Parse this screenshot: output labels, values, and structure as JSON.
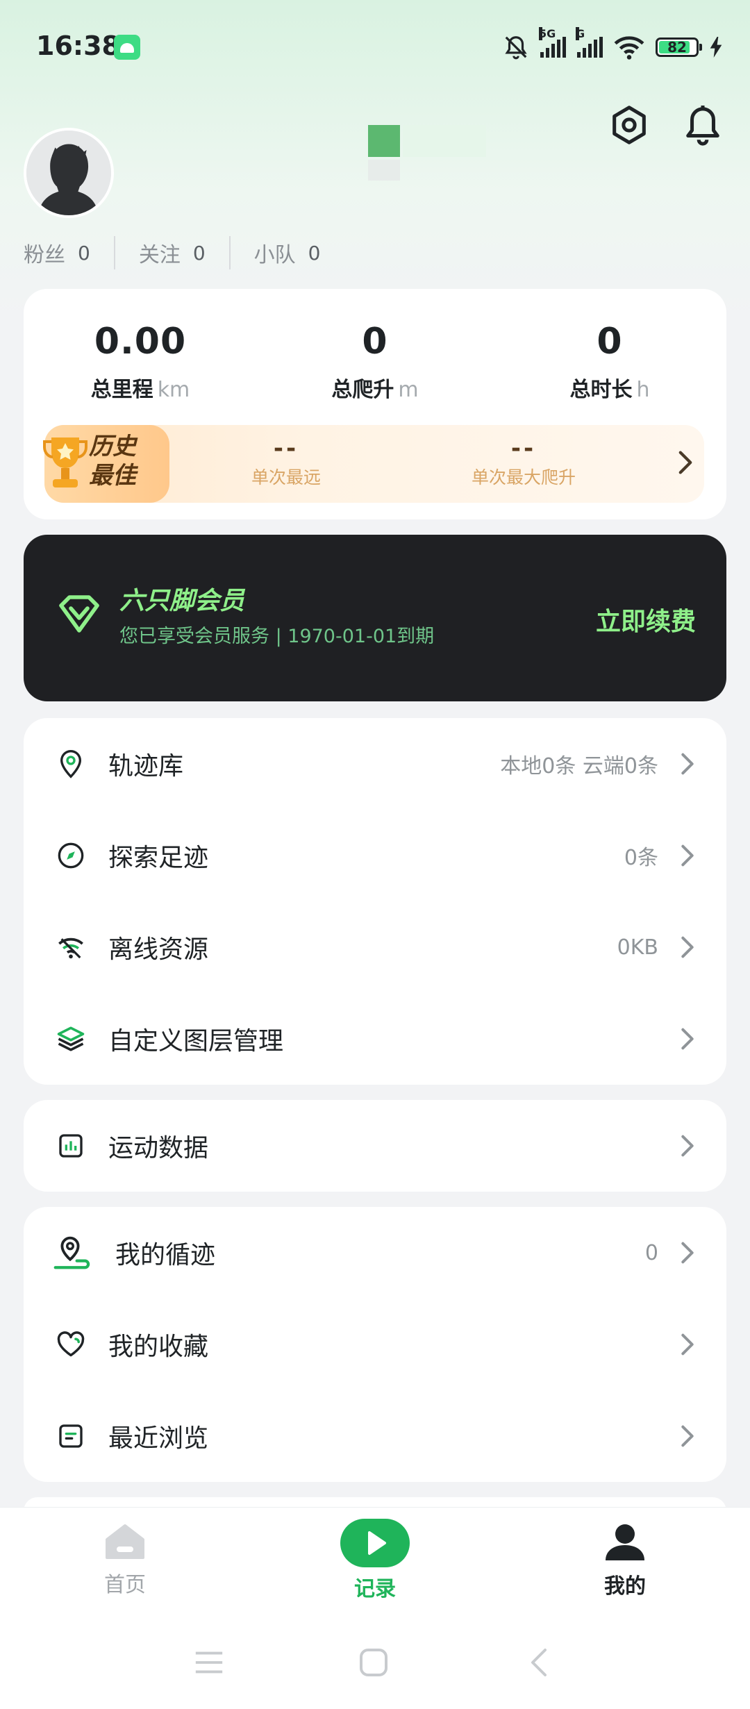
{
  "status_bar": {
    "time": "16:38",
    "battery": "82",
    "signal1_tag": "5G",
    "signal2_tag": "G"
  },
  "header": {
    "settings_icon": "settings-hex-icon",
    "bell_icon": "bell-icon"
  },
  "profile": {
    "stats": [
      {
        "label": "粉丝",
        "value": "0"
      },
      {
        "label": "关注",
        "value": "0"
      },
      {
        "label": "小队",
        "value": "0"
      }
    ]
  },
  "summary": {
    "distance": {
      "value": "0.00",
      "label": "总里程",
      "unit": "km"
    },
    "climb": {
      "value": "0",
      "label": "总爬升",
      "unit": "m"
    },
    "duration": {
      "value": "0",
      "label": "总时长",
      "unit": "h"
    },
    "best": {
      "badge_line1": "历史",
      "badge_line2": "最佳",
      "farthest": {
        "value": "--",
        "label": "单次最远"
      },
      "max_climb": {
        "value": "--",
        "label": "单次最大爬升"
      }
    }
  },
  "membership": {
    "title": "六只脚会员",
    "subtitle": "您已享受会员服务 | 1970-01-01到期",
    "button": "立即续费",
    "accent": "#8ff08a"
  },
  "list1": [
    {
      "icon": "location-pin-icon",
      "label": "轨迹库",
      "value": "本地0条 云端0条"
    },
    {
      "icon": "compass-icon",
      "label": "探索足迹",
      "value": "0条"
    },
    {
      "icon": "offline-wifi-icon",
      "label": "离线资源",
      "value": "0KB"
    },
    {
      "icon": "layers-icon",
      "label": "自定义图层管理",
      "value": ""
    }
  ],
  "list2": [
    {
      "icon": "bar-chart-icon",
      "label": "运动数据",
      "value": ""
    }
  ],
  "list3": [
    {
      "icon": "route-pin-icon",
      "label": "我的循迹",
      "value": "0"
    },
    {
      "icon": "heart-icon",
      "label": "我的收藏",
      "value": ""
    },
    {
      "icon": "document-icon",
      "label": "最近浏览",
      "value": ""
    }
  ],
  "tabs": [
    {
      "label": "首页",
      "icon": "home-icon",
      "active": false
    },
    {
      "label": "记录",
      "icon": "play-record-icon",
      "active": false
    },
    {
      "label": "我的",
      "icon": "person-icon",
      "active": true
    }
  ],
  "colors": {
    "brand_green": "#1fb45a",
    "gold": "#d9a565"
  }
}
